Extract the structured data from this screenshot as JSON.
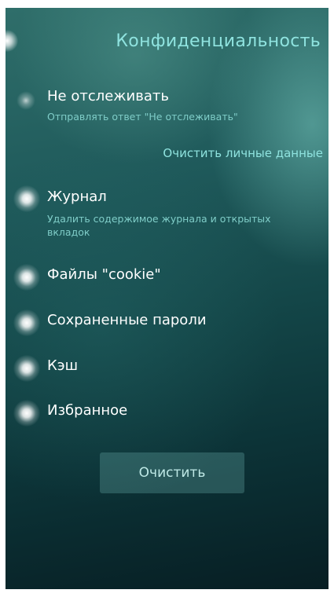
{
  "header": {
    "title": "Конфиденциальность"
  },
  "do_not_track": {
    "label": "Не отслеживать",
    "description": "Отправлять ответ \"Не отслеживать\"",
    "enabled": false
  },
  "clear_section": {
    "title": "Очистить личные данные",
    "items": [
      {
        "label": "Журнал",
        "description": "Удалить содержимое журнала и открытых вкладок",
        "checked": true
      },
      {
        "label": "Файлы \"cookie\"",
        "checked": true
      },
      {
        "label": "Сохраненные пароли",
        "checked": true
      },
      {
        "label": "Кэш",
        "checked": true
      },
      {
        "label": "Избранное",
        "checked": true
      }
    ],
    "button_label": "Очистить"
  }
}
